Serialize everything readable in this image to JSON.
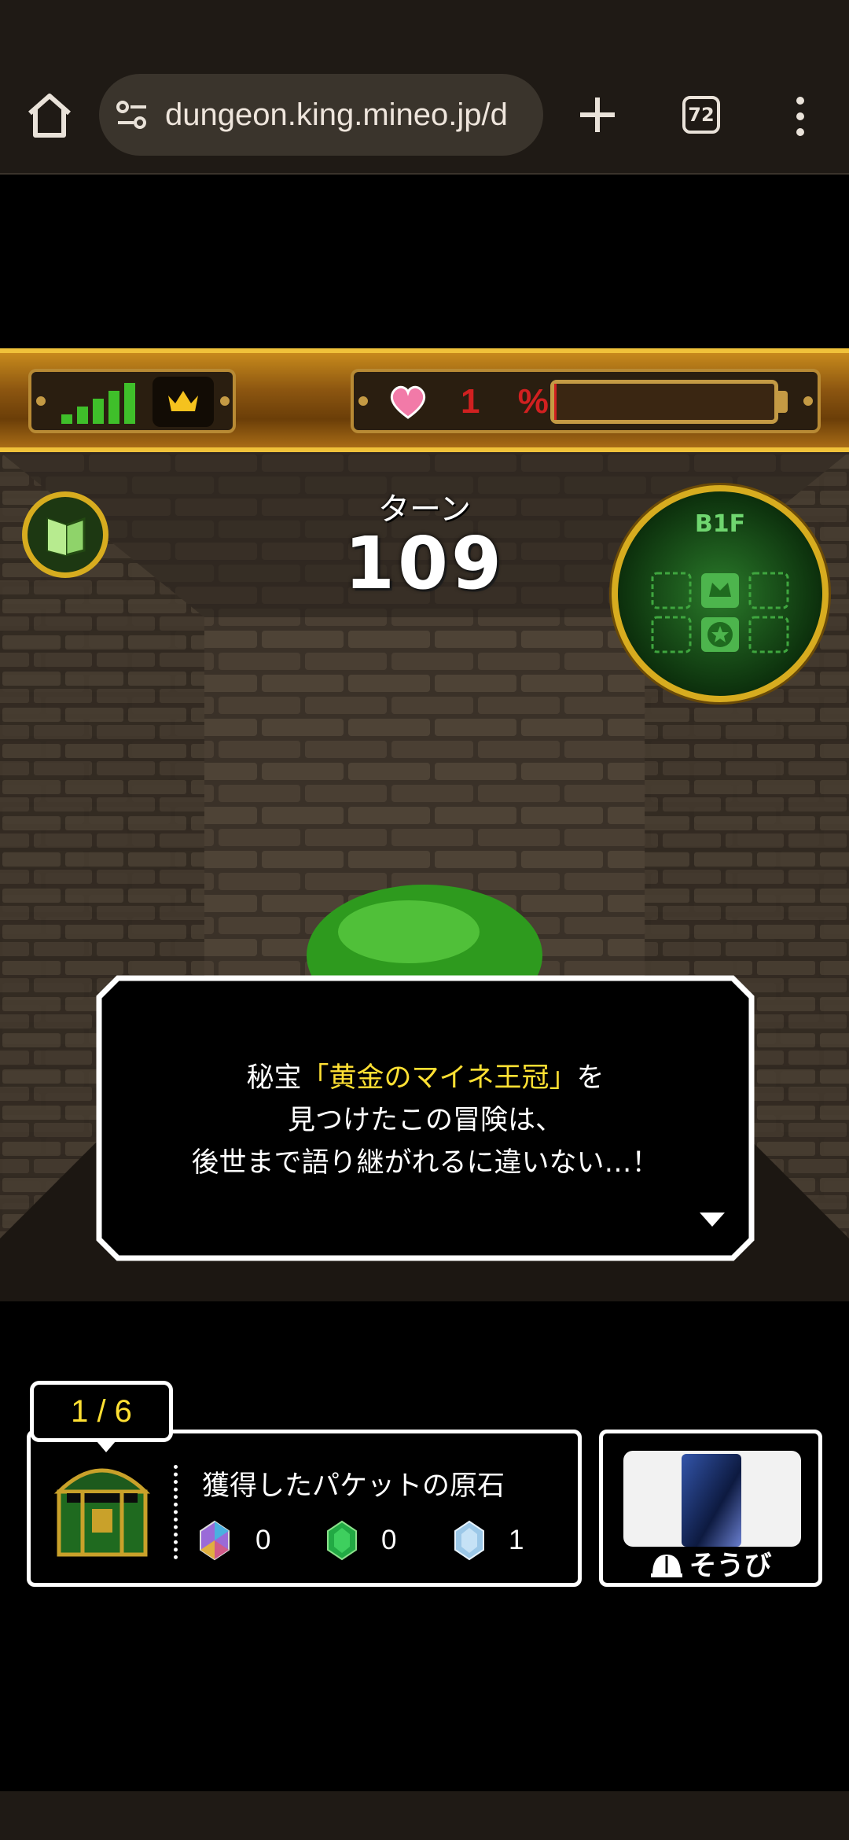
{
  "browser": {
    "url": "dungeon.king.mineo.jp/d",
    "tab_count": "72"
  },
  "hud": {
    "hp_percent_label": "1 %",
    "hp_fraction": 0.01,
    "signal_bars": 5
  },
  "game": {
    "turn_label": "ターン",
    "turn_value": "109",
    "floor": "B1F"
  },
  "dialog": {
    "line1_prefix": "秘宝",
    "line1_highlight": "「黄金のマイネ王冠」",
    "line1_suffix": "を",
    "line2": "見つけたこの冒険は、",
    "line3": "後世まで語り継がれるに違いない…！"
  },
  "loot": {
    "page_indicator": "1 / 6",
    "title": "獲得したパケットの原石",
    "gems": [
      {
        "icon": "rainbow-gem-icon",
        "count": "0",
        "color": "#b070e0"
      },
      {
        "icon": "green-gem-icon",
        "count": "0",
        "color": "#22aa44"
      },
      {
        "icon": "blue-gem-icon",
        "count": "1",
        "color": "#9cc8e8"
      }
    ]
  },
  "equipment": {
    "label": "そうび"
  },
  "colors": {
    "highlight": "#ffe033",
    "gold": "#d7ac1f",
    "hp_red": "#d12020"
  }
}
